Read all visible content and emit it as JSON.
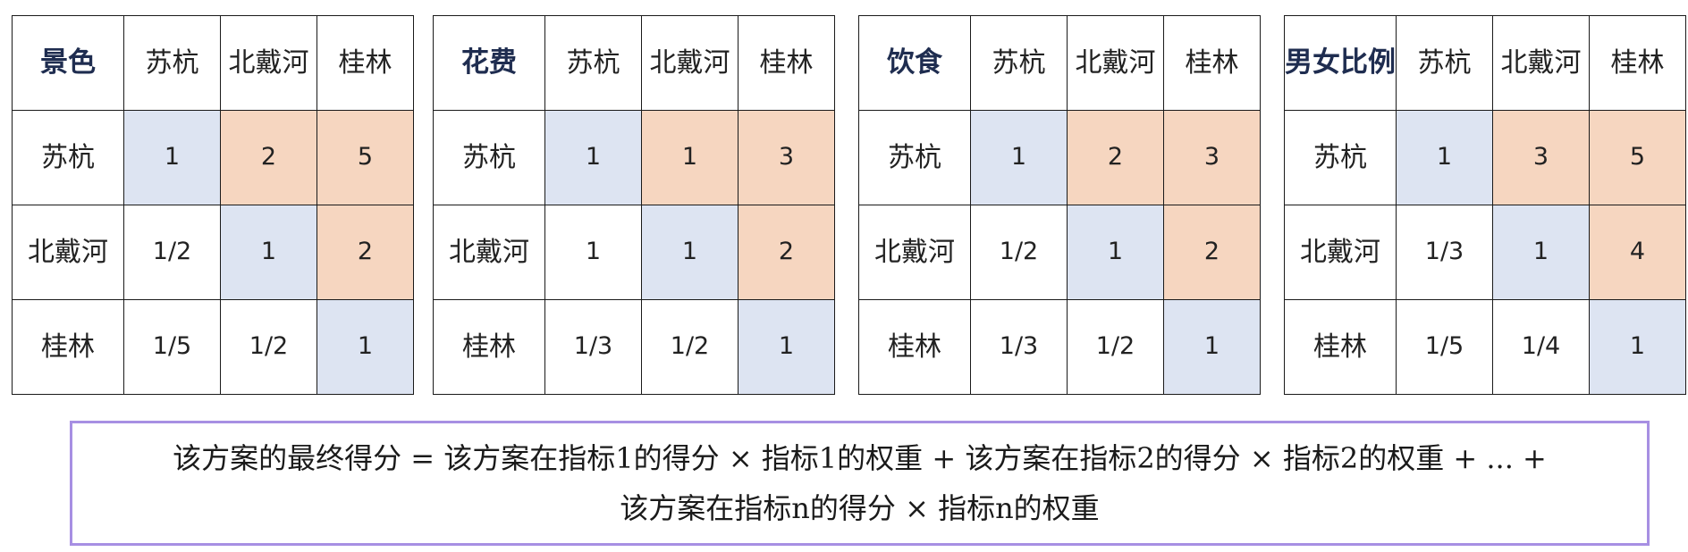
{
  "matrices": [
    {
      "corner": "景色",
      "columns": [
        "苏杭",
        "北戴河",
        "桂林"
      ],
      "rows": [
        {
          "label": "苏杭",
          "values": [
            "1",
            "2",
            "5"
          ]
        },
        {
          "label": "北戴河",
          "values": [
            "1/2",
            "1",
            "2"
          ]
        },
        {
          "label": "桂林",
          "values": [
            "1/5",
            "1/2",
            "1"
          ]
        }
      ]
    },
    {
      "corner": "花费",
      "columns": [
        "苏杭",
        "北戴河",
        "桂林"
      ],
      "rows": [
        {
          "label": "苏杭",
          "values": [
            "1",
            "1",
            "3"
          ]
        },
        {
          "label": "北戴河",
          "values": [
            "1",
            "1",
            "2"
          ]
        },
        {
          "label": "桂林",
          "values": [
            "1/3",
            "1/2",
            "1"
          ]
        }
      ]
    },
    {
      "corner": "饮食",
      "columns": [
        "苏杭",
        "北戴河",
        "桂林"
      ],
      "rows": [
        {
          "label": "苏杭",
          "values": [
            "1",
            "2",
            "3"
          ]
        },
        {
          "label": "北戴河",
          "values": [
            "1/2",
            "1",
            "2"
          ]
        },
        {
          "label": "桂林",
          "values": [
            "1/3",
            "1/2",
            "1"
          ]
        }
      ]
    },
    {
      "corner": "男女比例",
      "columns": [
        "苏杭",
        "北戴河",
        "桂林"
      ],
      "rows": [
        {
          "label": "苏杭",
          "values": [
            "1",
            "3",
            "5"
          ]
        },
        {
          "label": "北戴河",
          "values": [
            "1/3",
            "1",
            "4"
          ]
        },
        {
          "label": "桂林",
          "values": [
            "1/5",
            "1/4",
            "1"
          ]
        }
      ]
    }
  ],
  "formula": {
    "line1": "该方案的最终得分 = 该方案在指标1的得分 × 指标1的权重 + 该方案在指标2的得分 × 指标2的权重 + ... +",
    "line2": "该方案在指标n的得分 × 指标n的权重"
  },
  "colors": {
    "diagonal_fill": "#dde4f2",
    "upper_fill": "#f6d6c0",
    "corner_text": "#1f2d50",
    "formula_border": "#a78fe3"
  }
}
